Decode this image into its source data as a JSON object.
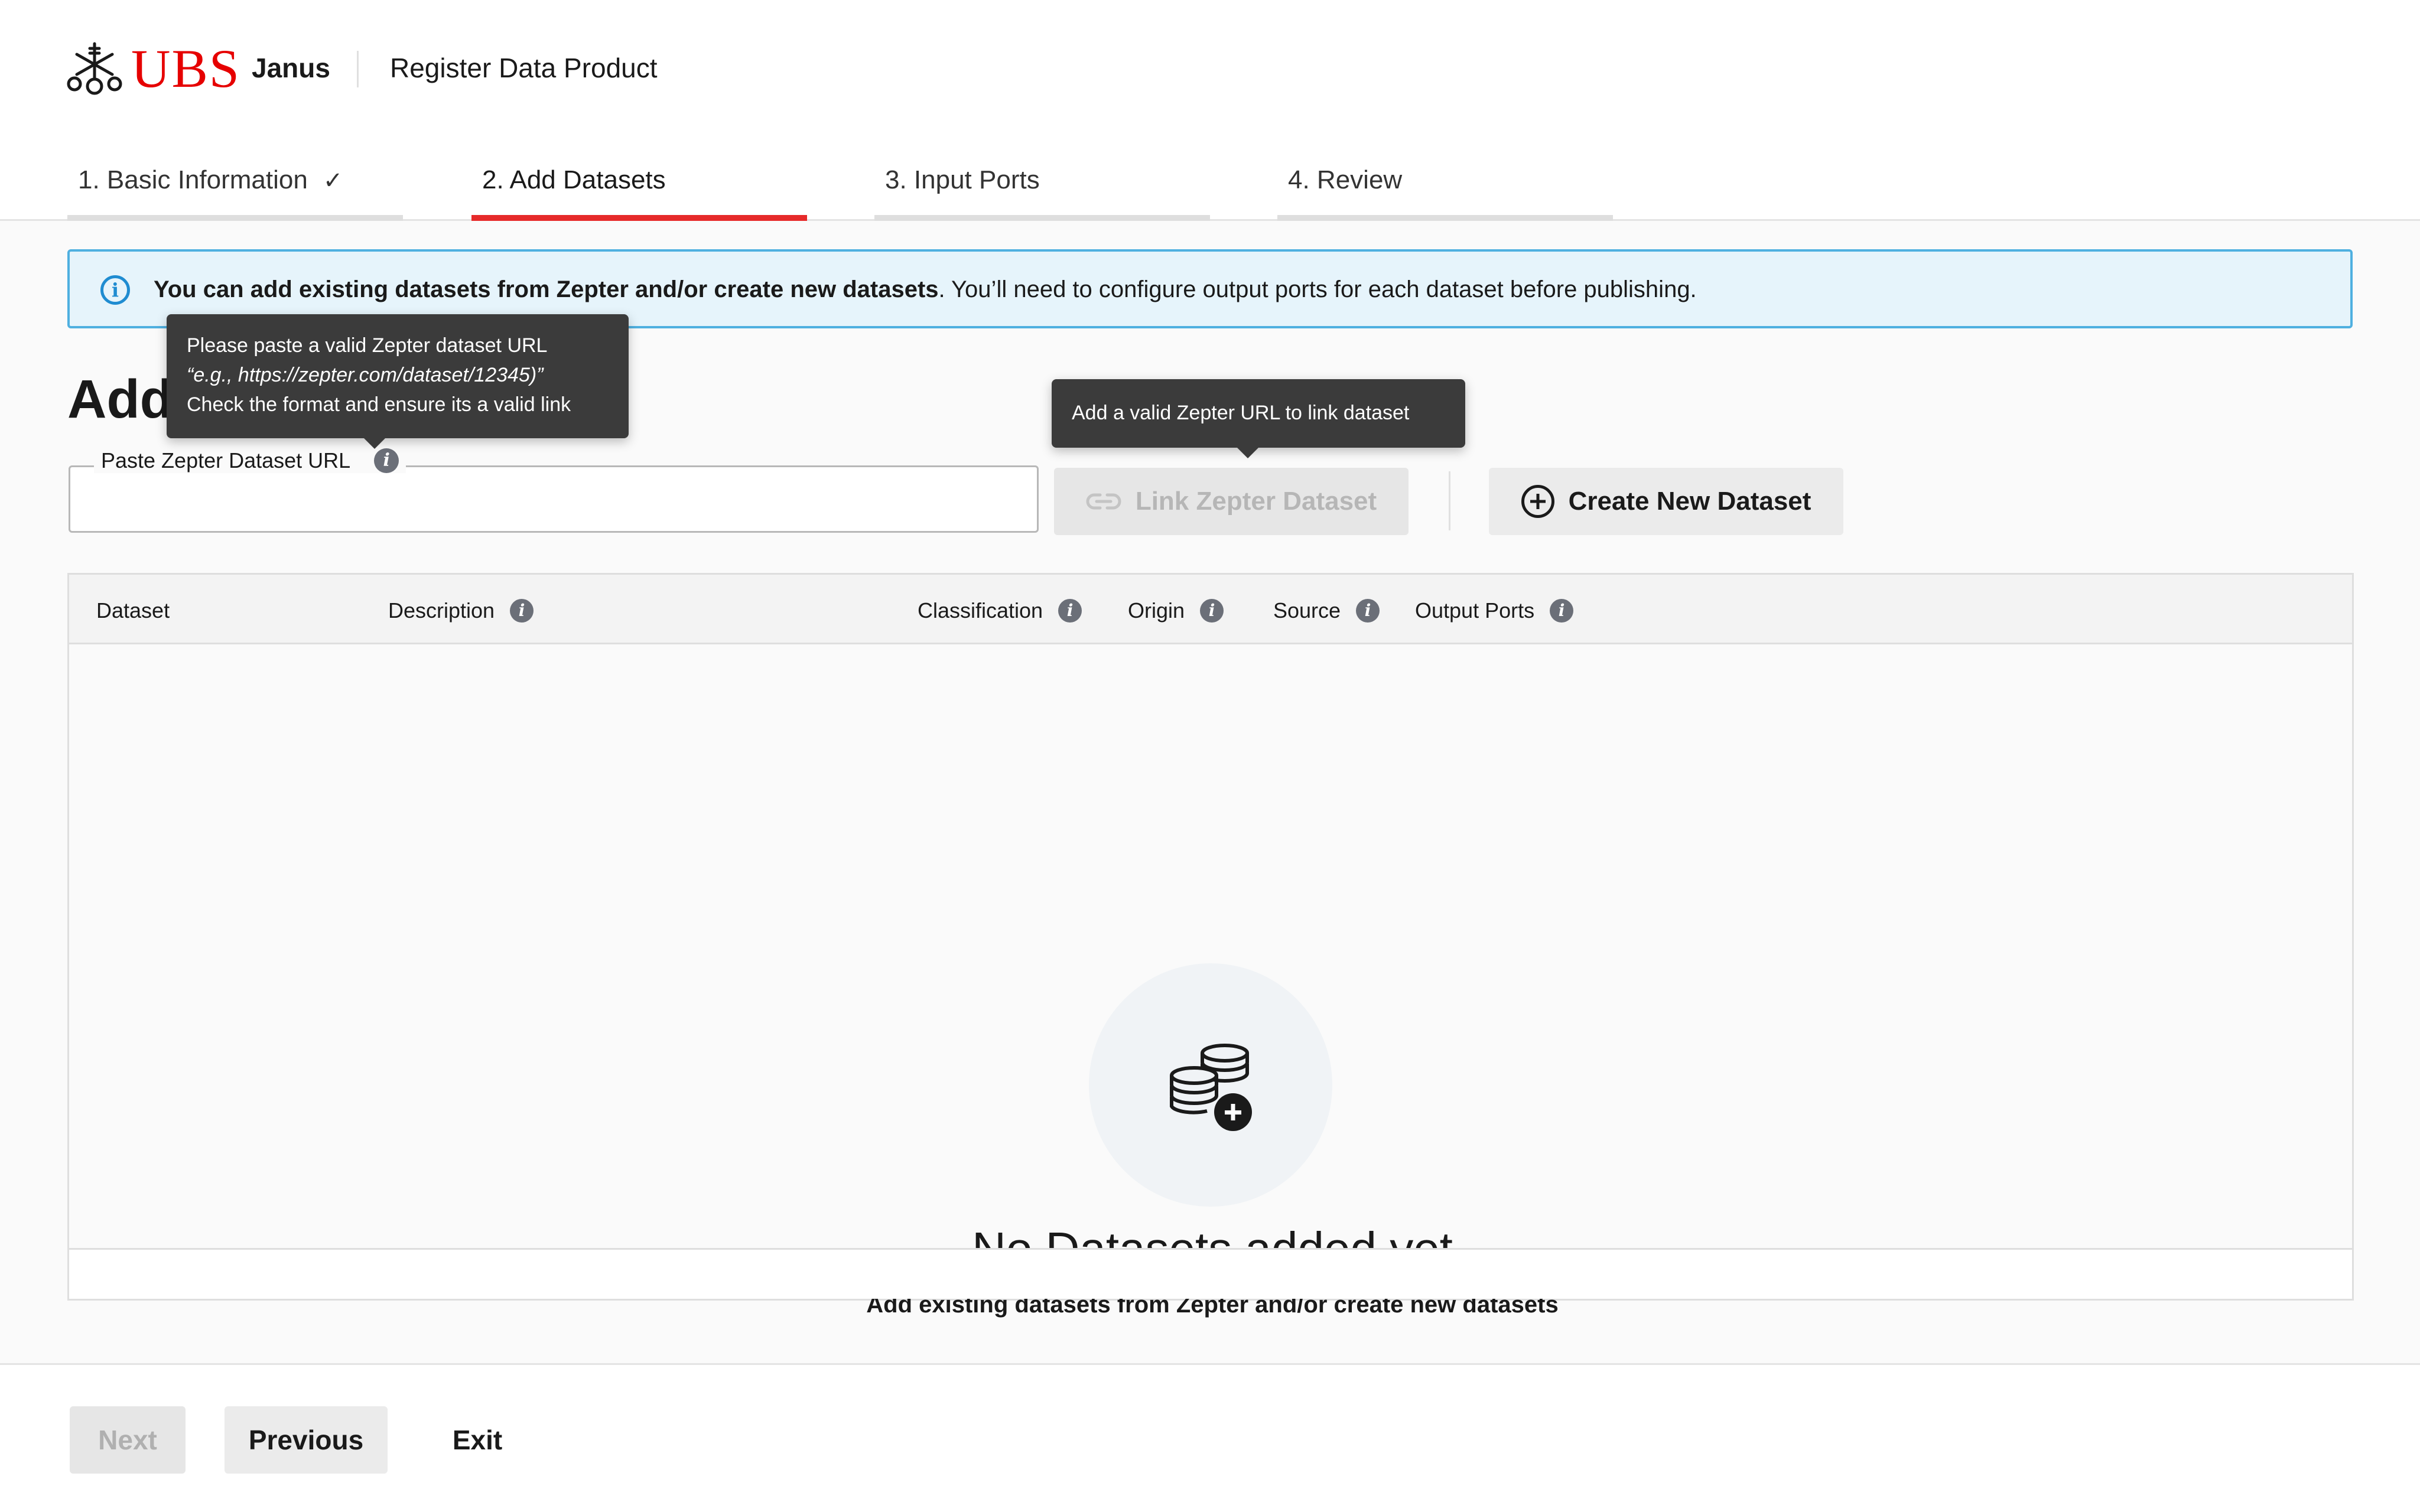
{
  "header": {
    "brand": "UBS",
    "app_name": "Janus",
    "page_title": "Register Data Product"
  },
  "steps": [
    {
      "label": "1. Basic Information",
      "completed": true
    },
    {
      "label": "2. Add Datasets",
      "active": true
    },
    {
      "label": "3. Input Ports"
    },
    {
      "label": "4. Review"
    }
  ],
  "banner": {
    "bold": "You can add existing datasets from Zepter and/or create new datasets",
    "text": ". You’ll need to configure output ports for each dataset before publishing.",
    "icon": "info-icon"
  },
  "section_title": "Add Datasets",
  "url_field": {
    "label": "Paste Zepter Dataset URL",
    "value": "",
    "placeholder": ""
  },
  "tooltips": {
    "url_lines": [
      "Please paste a valid Zepter dataset URL",
      "“e.g., https://zepter.com/dataset/12345)”",
      "Check the format and ensure its a valid link"
    ],
    "link": "Add a valid Zepter URL to link dataset"
  },
  "buttons": {
    "link_dataset": "Link Zepter Dataset",
    "create_dataset": "Create New Dataset"
  },
  "table": {
    "columns": [
      {
        "label": "Dataset",
        "info": false
      },
      {
        "label": "Description",
        "info": true
      },
      {
        "label": "Classification",
        "info": true
      },
      {
        "label": "Origin",
        "info": true
      },
      {
        "label": "Source",
        "info": true
      },
      {
        "label": "Output Ports",
        "info": true
      }
    ],
    "rows": []
  },
  "empty_state": {
    "title": "No Datasets added yet",
    "subtitle": "Add existing datasets from Zepter and/or create new datasets",
    "icon": "database-add-icon"
  },
  "footer": {
    "next": "Next",
    "previous": "Previous",
    "exit": "Exit"
  },
  "colors": {
    "brand_red": "#e60000",
    "active_step": "#e62a2a",
    "info_blue": "#1f8cd1",
    "banner_bg": "#e6f4fb"
  }
}
